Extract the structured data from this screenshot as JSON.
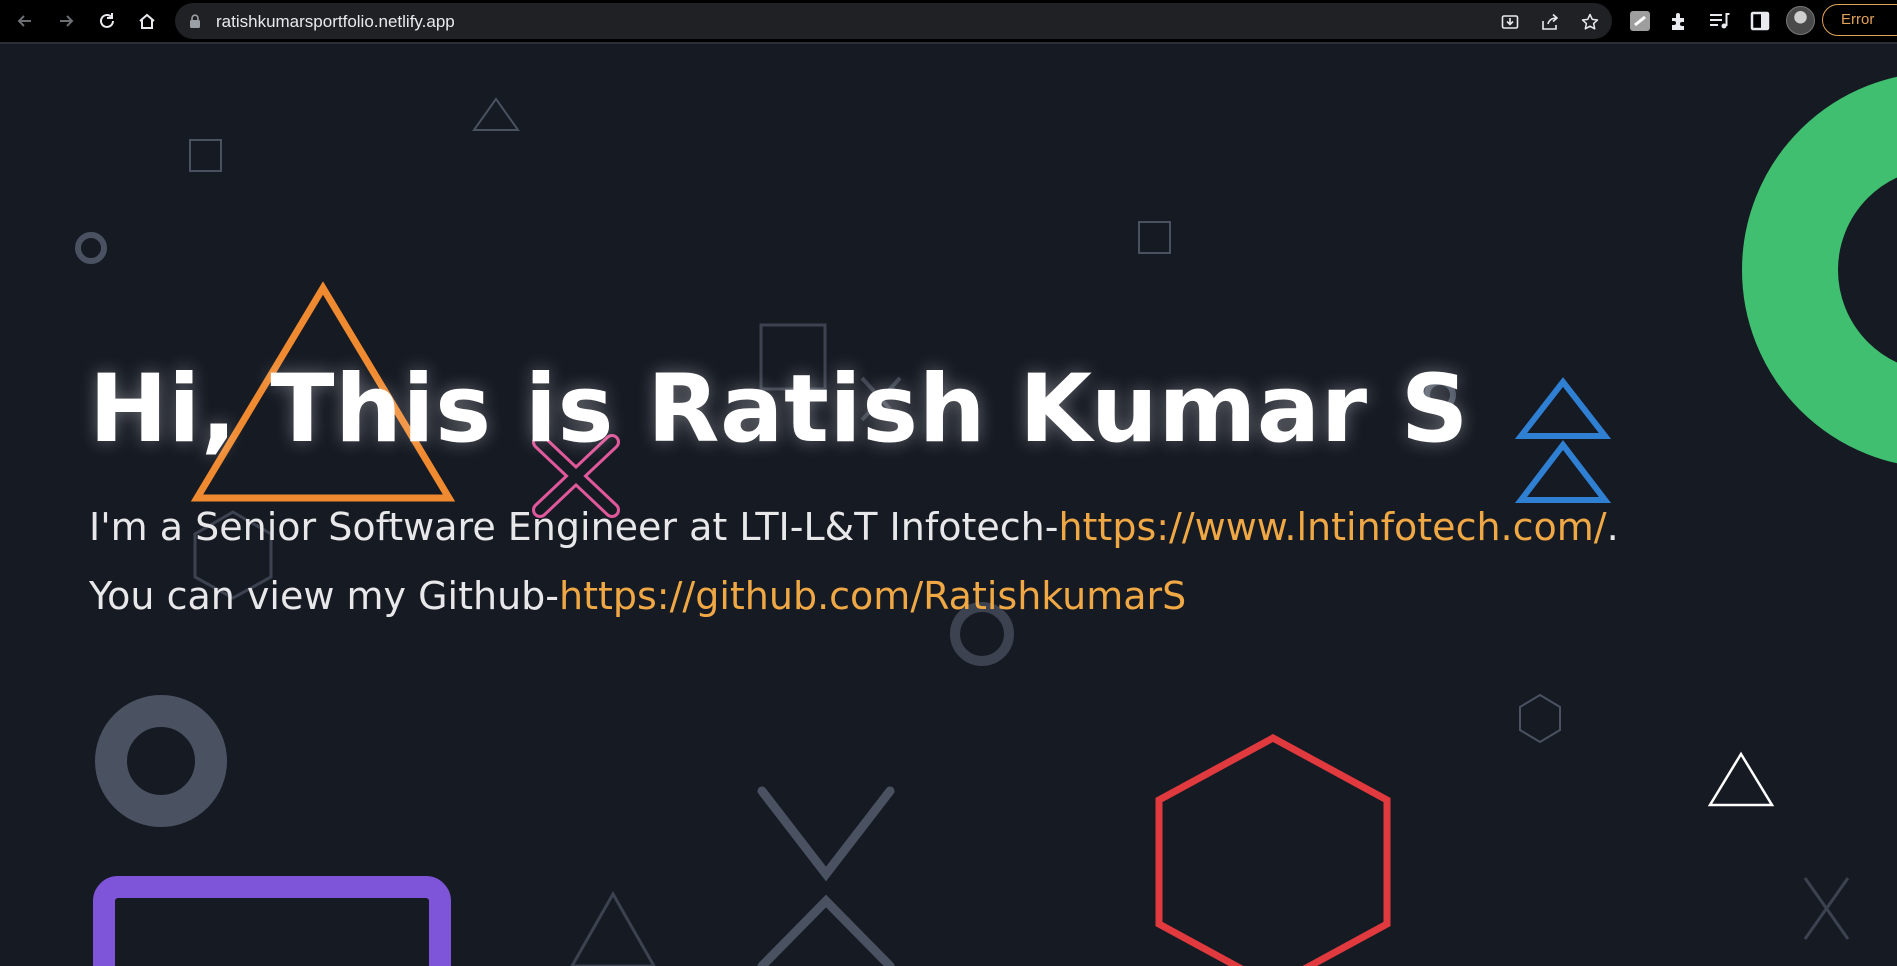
{
  "browser": {
    "url": "ratishkumarsportfolio.netlify.app",
    "error_label": "Error",
    "icons": {
      "back": "back-arrow-icon",
      "forward": "forward-arrow-icon",
      "reload": "reload-icon",
      "home": "home-icon",
      "lock": "lock-icon",
      "install": "install-app-icon",
      "share": "share-icon",
      "bookmark": "star-icon",
      "extension_1": "extension-icon",
      "extensions": "puzzle-icon",
      "media": "media-queue-icon",
      "side_panel": "side-panel-icon",
      "profile": "profile-avatar",
      "menu": "kebab-menu-icon"
    }
  },
  "hero": {
    "title": "Hi, This is Ratish Kumar S",
    "line1_text": "I'm a Senior Software Engineer at LTI-L&T Infotech-",
    "line1_link": "https://www.lntinfotech.com/",
    "line1_suffix": ".",
    "line2_text": "You can view my Github-",
    "line2_link": "https://github.com/RatishkumarS"
  },
  "colors": {
    "background": "#161a23",
    "link": "#f0a845",
    "title": "#ffffff",
    "shape_orange": "#f08a30",
    "shape_pink": "#e0589b",
    "shape_blue": "#2f7fd3",
    "shape_green": "#3fbf6f",
    "shape_red": "#e0393e",
    "shape_purple": "#7e54d8",
    "shape_gray": "#4a5262",
    "shape_white": "#ffffff"
  }
}
